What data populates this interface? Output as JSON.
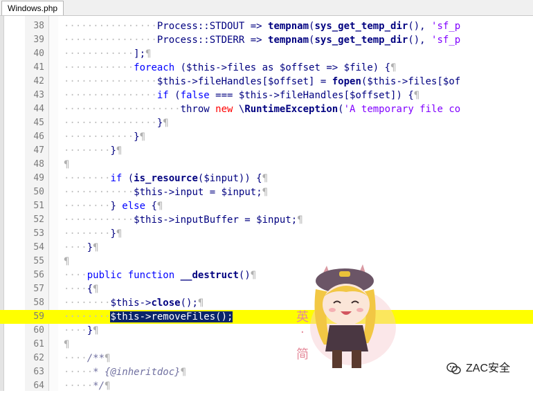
{
  "tab": {
    "label": "Windows.php"
  },
  "watermark": {
    "text": "ZAC安全"
  },
  "sticker": {
    "glyphs": [
      "英",
      "·",
      "简"
    ]
  },
  "lines": [
    {
      "n": "38",
      "hl": false,
      "segs": [
        {
          "t": "dots",
          "v": "················"
        },
        {
          "t": "var",
          "v": "Process::STDOUT => "
        },
        {
          "t": "fn",
          "v": "tempnam"
        },
        {
          "t": "op",
          "v": "("
        },
        {
          "t": "fn",
          "v": "sys_get_temp_dir"
        },
        {
          "t": "op",
          "v": "(), "
        },
        {
          "t": "str",
          "v": "'sf_p"
        }
      ]
    },
    {
      "n": "39",
      "hl": false,
      "segs": [
        {
          "t": "dots",
          "v": "················"
        },
        {
          "t": "var",
          "v": "Process::STDERR => "
        },
        {
          "t": "fn",
          "v": "tempnam"
        },
        {
          "t": "op",
          "v": "("
        },
        {
          "t": "fn",
          "v": "sys_get_temp_dir"
        },
        {
          "t": "op",
          "v": "(), "
        },
        {
          "t": "str",
          "v": "'sf_p"
        }
      ]
    },
    {
      "n": "40",
      "hl": false,
      "segs": [
        {
          "t": "dots",
          "v": "············"
        },
        {
          "t": "op",
          "v": "];"
        },
        {
          "t": "pil",
          "v": "¶"
        }
      ]
    },
    {
      "n": "41",
      "hl": false,
      "segs": [
        {
          "t": "dots",
          "v": "············"
        },
        {
          "t": "kw",
          "v": "foreach"
        },
        {
          "t": "op",
          "v": " ("
        },
        {
          "t": "var",
          "v": "$this->files"
        },
        {
          "t": "op",
          "v": " as "
        },
        {
          "t": "var",
          "v": "$offset"
        },
        {
          "t": "op",
          "v": " => "
        },
        {
          "t": "var",
          "v": "$file"
        },
        {
          "t": "op",
          "v": ") {"
        },
        {
          "t": "pil",
          "v": "¶"
        }
      ]
    },
    {
      "n": "42",
      "hl": false,
      "segs": [
        {
          "t": "dots",
          "v": "················"
        },
        {
          "t": "var",
          "v": "$this->fileHandles[$offset]"
        },
        {
          "t": "op",
          "v": " = "
        },
        {
          "t": "fn",
          "v": "fopen"
        },
        {
          "t": "op",
          "v": "("
        },
        {
          "t": "var",
          "v": "$this->files[$of"
        }
      ]
    },
    {
      "n": "43",
      "hl": false,
      "segs": [
        {
          "t": "dots",
          "v": "················"
        },
        {
          "t": "kw",
          "v": "if"
        },
        {
          "t": "op",
          "v": " ("
        },
        {
          "t": "kw",
          "v": "false"
        },
        {
          "t": "op",
          "v": " === "
        },
        {
          "t": "var",
          "v": "$this->fileHandles[$offset]"
        },
        {
          "t": "op",
          "v": ") {"
        },
        {
          "t": "pil",
          "v": "¶"
        }
      ]
    },
    {
      "n": "44",
      "hl": false,
      "segs": [
        {
          "t": "dots",
          "v": "····················"
        },
        {
          "t": "var",
          "v": "throw "
        },
        {
          "t": "red",
          "v": "new"
        },
        {
          "t": "op",
          "v": " \\"
        },
        {
          "t": "fn",
          "v": "RuntimeException"
        },
        {
          "t": "op",
          "v": "("
        },
        {
          "t": "str",
          "v": "'A temporary file co"
        }
      ]
    },
    {
      "n": "45",
      "hl": false,
      "segs": [
        {
          "t": "dots",
          "v": "················"
        },
        {
          "t": "op",
          "v": "}"
        },
        {
          "t": "pil",
          "v": "¶"
        }
      ]
    },
    {
      "n": "46",
      "hl": false,
      "segs": [
        {
          "t": "dots",
          "v": "············"
        },
        {
          "t": "op",
          "v": "}"
        },
        {
          "t": "pil",
          "v": "¶"
        }
      ]
    },
    {
      "n": "47",
      "hl": false,
      "segs": [
        {
          "t": "dots",
          "v": "········"
        },
        {
          "t": "op",
          "v": "}"
        },
        {
          "t": "pil",
          "v": "¶"
        }
      ]
    },
    {
      "n": "48",
      "hl": false,
      "segs": [
        {
          "t": "pil",
          "v": "¶"
        }
      ]
    },
    {
      "n": "49",
      "hl": false,
      "segs": [
        {
          "t": "dots",
          "v": "········"
        },
        {
          "t": "kw",
          "v": "if"
        },
        {
          "t": "op",
          "v": " ("
        },
        {
          "t": "fn",
          "v": "is_resource"
        },
        {
          "t": "op",
          "v": "("
        },
        {
          "t": "var",
          "v": "$input"
        },
        {
          "t": "op",
          "v": ")) {"
        },
        {
          "t": "pil",
          "v": "¶"
        }
      ]
    },
    {
      "n": "50",
      "hl": false,
      "segs": [
        {
          "t": "dots",
          "v": "············"
        },
        {
          "t": "var",
          "v": "$this->input"
        },
        {
          "t": "op",
          "v": " = "
        },
        {
          "t": "var",
          "v": "$input"
        },
        {
          "t": "op",
          "v": ";"
        },
        {
          "t": "pil",
          "v": "¶"
        }
      ]
    },
    {
      "n": "51",
      "hl": false,
      "segs": [
        {
          "t": "dots",
          "v": "········"
        },
        {
          "t": "op",
          "v": "} "
        },
        {
          "t": "kw",
          "v": "else"
        },
        {
          "t": "op",
          "v": " {"
        },
        {
          "t": "pil",
          "v": "¶"
        }
      ]
    },
    {
      "n": "52",
      "hl": false,
      "segs": [
        {
          "t": "dots",
          "v": "············"
        },
        {
          "t": "var",
          "v": "$this->inputBuffer"
        },
        {
          "t": "op",
          "v": " = "
        },
        {
          "t": "var",
          "v": "$input"
        },
        {
          "t": "op",
          "v": ";"
        },
        {
          "t": "pil",
          "v": "¶"
        }
      ]
    },
    {
      "n": "53",
      "hl": false,
      "segs": [
        {
          "t": "dots",
          "v": "········"
        },
        {
          "t": "op",
          "v": "}"
        },
        {
          "t": "pil",
          "v": "¶"
        }
      ]
    },
    {
      "n": "54",
      "hl": false,
      "segs": [
        {
          "t": "dots",
          "v": "····"
        },
        {
          "t": "op",
          "v": "}"
        },
        {
          "t": "pil",
          "v": "¶"
        }
      ]
    },
    {
      "n": "55",
      "hl": false,
      "segs": [
        {
          "t": "pil",
          "v": "¶"
        }
      ]
    },
    {
      "n": "56",
      "hl": false,
      "segs": [
        {
          "t": "dots",
          "v": "····"
        },
        {
          "t": "kw",
          "v": "public"
        },
        {
          "t": "op",
          "v": " "
        },
        {
          "t": "kw",
          "v": "function"
        },
        {
          "t": "op",
          "v": " "
        },
        {
          "t": "fn",
          "v": "__destruct"
        },
        {
          "t": "op",
          "v": "()"
        },
        {
          "t": "pil",
          "v": "¶"
        }
      ]
    },
    {
      "n": "57",
      "hl": false,
      "segs": [
        {
          "t": "dots",
          "v": "····"
        },
        {
          "t": "op",
          "v": "{"
        },
        {
          "t": "pil",
          "v": "¶"
        }
      ]
    },
    {
      "n": "58",
      "hl": false,
      "segs": [
        {
          "t": "dots",
          "v": "········"
        },
        {
          "t": "var",
          "v": "$this->"
        },
        {
          "t": "fn",
          "v": "close"
        },
        {
          "t": "op",
          "v": "();"
        },
        {
          "t": "pil",
          "v": "¶"
        }
      ]
    },
    {
      "n": "59",
      "hl": true,
      "segs": [
        {
          "t": "dots",
          "v": "········"
        },
        {
          "t": "sel",
          "v": "$this->removeFiles();"
        }
      ]
    },
    {
      "n": "60",
      "hl": false,
      "segs": [
        {
          "t": "dots",
          "v": "····"
        },
        {
          "t": "op",
          "v": "}"
        },
        {
          "t": "pil",
          "v": "¶"
        }
      ]
    },
    {
      "n": "61",
      "hl": false,
      "segs": [
        {
          "t": "pil",
          "v": "¶"
        }
      ]
    },
    {
      "n": "62",
      "hl": false,
      "segs": [
        {
          "t": "dots",
          "v": "····"
        },
        {
          "t": "cm",
          "v": "/**"
        },
        {
          "t": "pil",
          "v": "¶"
        }
      ]
    },
    {
      "n": "63",
      "hl": false,
      "segs": [
        {
          "t": "dots",
          "v": "·····"
        },
        {
          "t": "cm",
          "v": "* {@inheritdoc}"
        },
        {
          "t": "pil",
          "v": "¶"
        }
      ]
    },
    {
      "n": "64",
      "hl": false,
      "segs": [
        {
          "t": "dots",
          "v": "·····"
        },
        {
          "t": "cm",
          "v": "*/"
        },
        {
          "t": "pil",
          "v": "¶"
        }
      ]
    }
  ]
}
